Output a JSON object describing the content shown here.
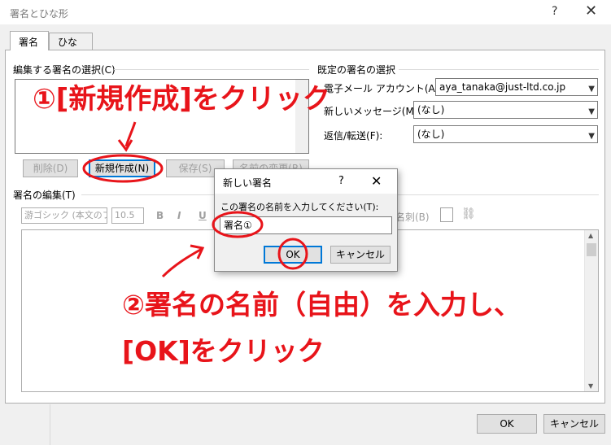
{
  "window": {
    "title": "署名とひな形",
    "help": "?",
    "close": "✕"
  },
  "tabs": [
    {
      "label": "署名",
      "active": true
    },
    {
      "label": "ひな形",
      "active": false
    }
  ],
  "edit_select": {
    "label": "編集する署名の選択(C)",
    "buttons": {
      "delete": "削除(D)",
      "new": "新規作成(N)",
      "save": "保存(S)",
      "rename": "名前の変更(R)"
    }
  },
  "default_sig": {
    "label": "既定の署名の選択",
    "account_label": "電子メール アカウント(A):",
    "account_value": "aya_tanaka@just-ltd.co.jp",
    "new_msg_label": "新しいメッセージ(M):",
    "new_msg_value": "(なし)",
    "reply_label": "返信/転送(F):",
    "reply_value": "(なし)"
  },
  "editor": {
    "label": "署名の編集(T)",
    "font": "游ゴシック (本文のフ",
    "size": "10.5",
    "bold": "B",
    "italic": "I",
    "underline": "U",
    "business_card": "名刺(B)"
  },
  "dialog": {
    "title": "新しい署名",
    "help": "?",
    "close": "✕",
    "prompt": "この署名の名前を入力してください(T):",
    "input_value": "署名①",
    "ok": "OK",
    "cancel": "キャンセル"
  },
  "footer": {
    "ok": "OK",
    "cancel": "キャンセル"
  },
  "annotations": {
    "step1": "①[新規作成]をクリック",
    "step2_line1": "②署名の名前（自由）を入力し、",
    "step2_line2": "[OK]をクリック"
  },
  "colors": {
    "annotation_red": "#e8141a",
    "focus_blue": "#0078d7"
  }
}
